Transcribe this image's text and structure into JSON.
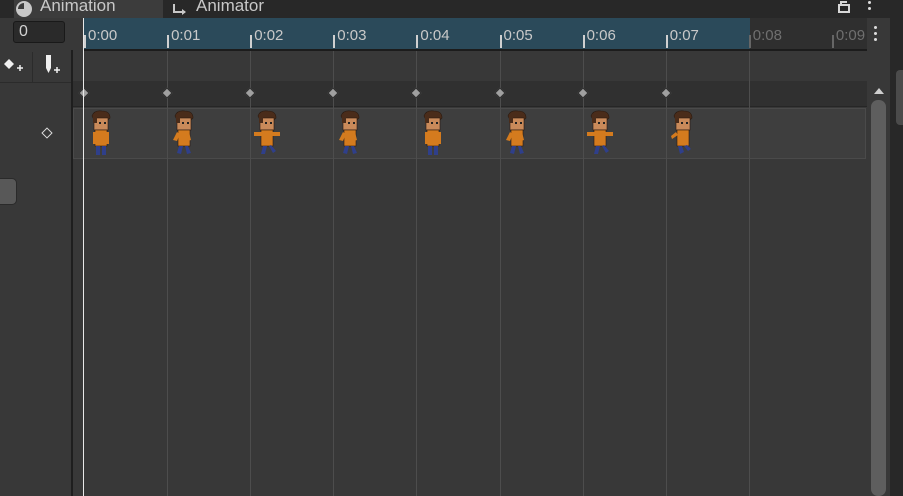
{
  "tabs": [
    {
      "label": "Animation",
      "icon": "clock-icon",
      "active": true
    },
    {
      "label": "Animator",
      "icon": "animator-graph-icon",
      "active": false
    }
  ],
  "window_controls": {
    "lock_icon": "lock-icon",
    "menu_icon": "kebab-menu-icon"
  },
  "frame": {
    "value": "0"
  },
  "toolbar": {
    "add_keyframe_icon": "add-keyframe-icon",
    "add_event_icon": "add-event-icon"
  },
  "timeline": {
    "ticks": [
      "0:00",
      "0:01",
      "0:02",
      "0:03",
      "0:04",
      "0:05",
      "0:06",
      "0:07",
      "0:08",
      "0:09"
    ],
    "clip_end_index": 7,
    "keyframe_count": 8,
    "playhead_frame": 0
  },
  "colors": {
    "ruler_active": "#2b4a5a",
    "ruler_inactive": "#2f2f2f",
    "background": "#383838",
    "keyframe": "#a0a0a0"
  },
  "sprite_poses": [
    "idle",
    "walk-a",
    "arms-out",
    "walk-b",
    "idle",
    "walk-a",
    "arms-out",
    "walk-c"
  ]
}
